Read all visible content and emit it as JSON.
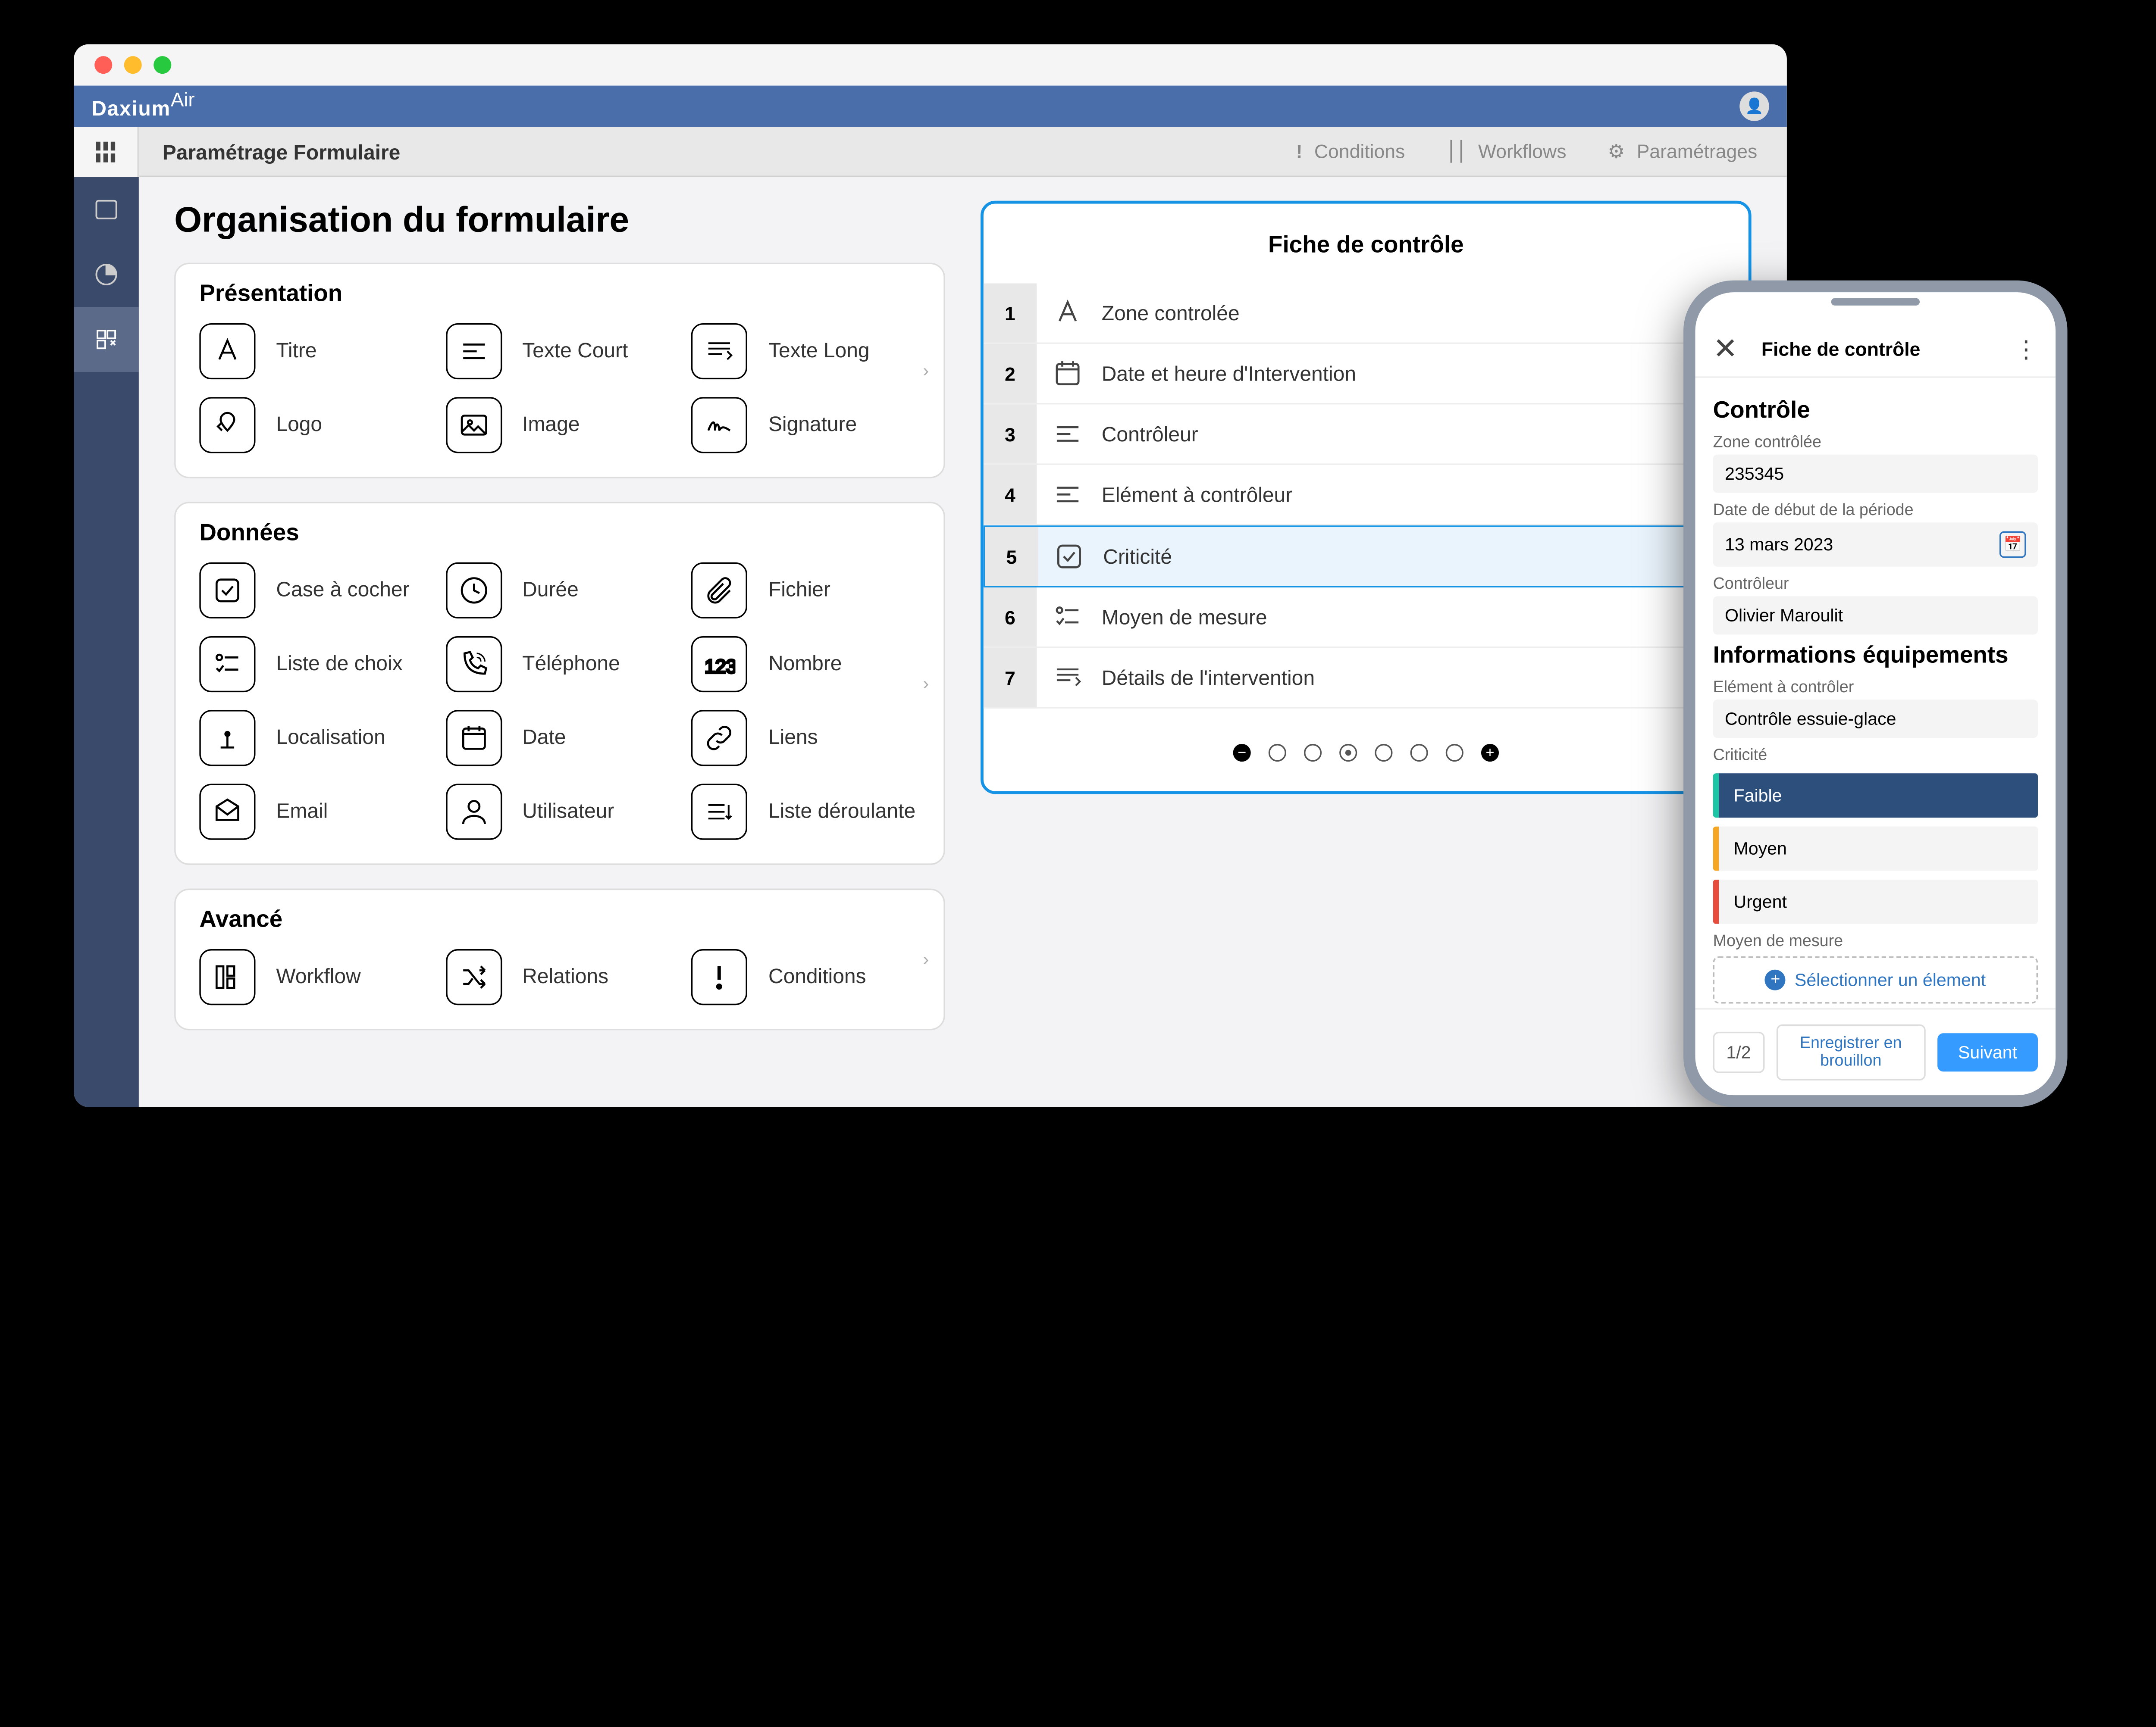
{
  "brand": "Daxium",
  "brand_suffix": "Air",
  "toolbar": {
    "title": "Paramétrage Formulaire",
    "items": [
      {
        "label": "Conditions"
      },
      {
        "label": "Workflows"
      },
      {
        "label": "Paramétrages"
      }
    ]
  },
  "page_title": "Organisation du formulaire",
  "panels": [
    {
      "title": "Présentation",
      "fields": [
        {
          "label": "Titre",
          "icon": "text-a"
        },
        {
          "label": "Texte Court",
          "icon": "text-short"
        },
        {
          "label": "Texte Long",
          "icon": "text-long"
        },
        {
          "label": "Logo",
          "icon": "logo"
        },
        {
          "label": "Image",
          "icon": "image"
        },
        {
          "label": "Signature",
          "icon": "signature"
        }
      ]
    },
    {
      "title": "Données",
      "fields": [
        {
          "label": "Case à cocher",
          "icon": "checkbox"
        },
        {
          "label": "Durée",
          "icon": "clock"
        },
        {
          "label": "Fichier",
          "icon": "attachment"
        },
        {
          "label": "Liste de choix",
          "icon": "list-check"
        },
        {
          "label": "Téléphone",
          "icon": "phone"
        },
        {
          "label": "Nombre",
          "icon": "number"
        },
        {
          "label": "Localisation",
          "icon": "location"
        },
        {
          "label": "Date",
          "icon": "calendar"
        },
        {
          "label": "Liens",
          "icon": "link"
        },
        {
          "label": "Email",
          "icon": "email"
        },
        {
          "label": "Utilisateur",
          "icon": "user"
        },
        {
          "label": "Liste déroulante",
          "icon": "dropdown"
        }
      ]
    },
    {
      "title": "Avancé",
      "fields": [
        {
          "label": "Workflow",
          "icon": "workflow"
        },
        {
          "label": "Relations",
          "icon": "shuffle"
        },
        {
          "label": "Conditions",
          "icon": "exclaim"
        }
      ]
    }
  ],
  "preview": {
    "title": "Fiche de contrôle",
    "rows": [
      {
        "num": "1",
        "label": "Zone controlée",
        "icon": "text-a"
      },
      {
        "num": "2",
        "label": "Date et heure d'Intervention",
        "icon": "calendar"
      },
      {
        "num": "3",
        "label": "Contrôleur",
        "icon": "text-short"
      },
      {
        "num": "4",
        "label": "Elément à contrôleur",
        "icon": "text-short"
      },
      {
        "num": "5",
        "label": "Criticité",
        "icon": "checkbox"
      },
      {
        "num": "6",
        "label": "Moyen de mesure",
        "icon": "list-check"
      },
      {
        "num": "7",
        "label": "Détails de l'intervention",
        "icon": "text-long"
      }
    ],
    "selected_index": 4
  },
  "phone": {
    "header_title": "Fiche de contrôle",
    "section1_title": "Contrôle",
    "fields": {
      "zone_label": "Zone contrôlée",
      "zone_value": "235345",
      "date_label": "Date de début de la période",
      "date_value": "13 mars 2023",
      "ctrl_label": "Contrôleur",
      "ctrl_value": "Olivier Maroulit"
    },
    "section2_title": "Informations équipements",
    "elem_label": "Elément à contrôler",
    "elem_value": "Contrôle essuie-glace",
    "crit_label": "Criticité",
    "crit_options": [
      {
        "label": "Faible",
        "color": "#1bc5a5",
        "selected": true
      },
      {
        "label": "Moyen",
        "color": "#f5a623",
        "selected": false
      },
      {
        "label": "Urgent",
        "color": "#e74c3c",
        "selected": false
      }
    ],
    "moyen_label": "Moyen de mesure",
    "moyen_select": "Sélectionner un élement",
    "footer": {
      "page": "1/2",
      "draft": "Enregistrer en brouillon",
      "next": "Suivant"
    }
  }
}
